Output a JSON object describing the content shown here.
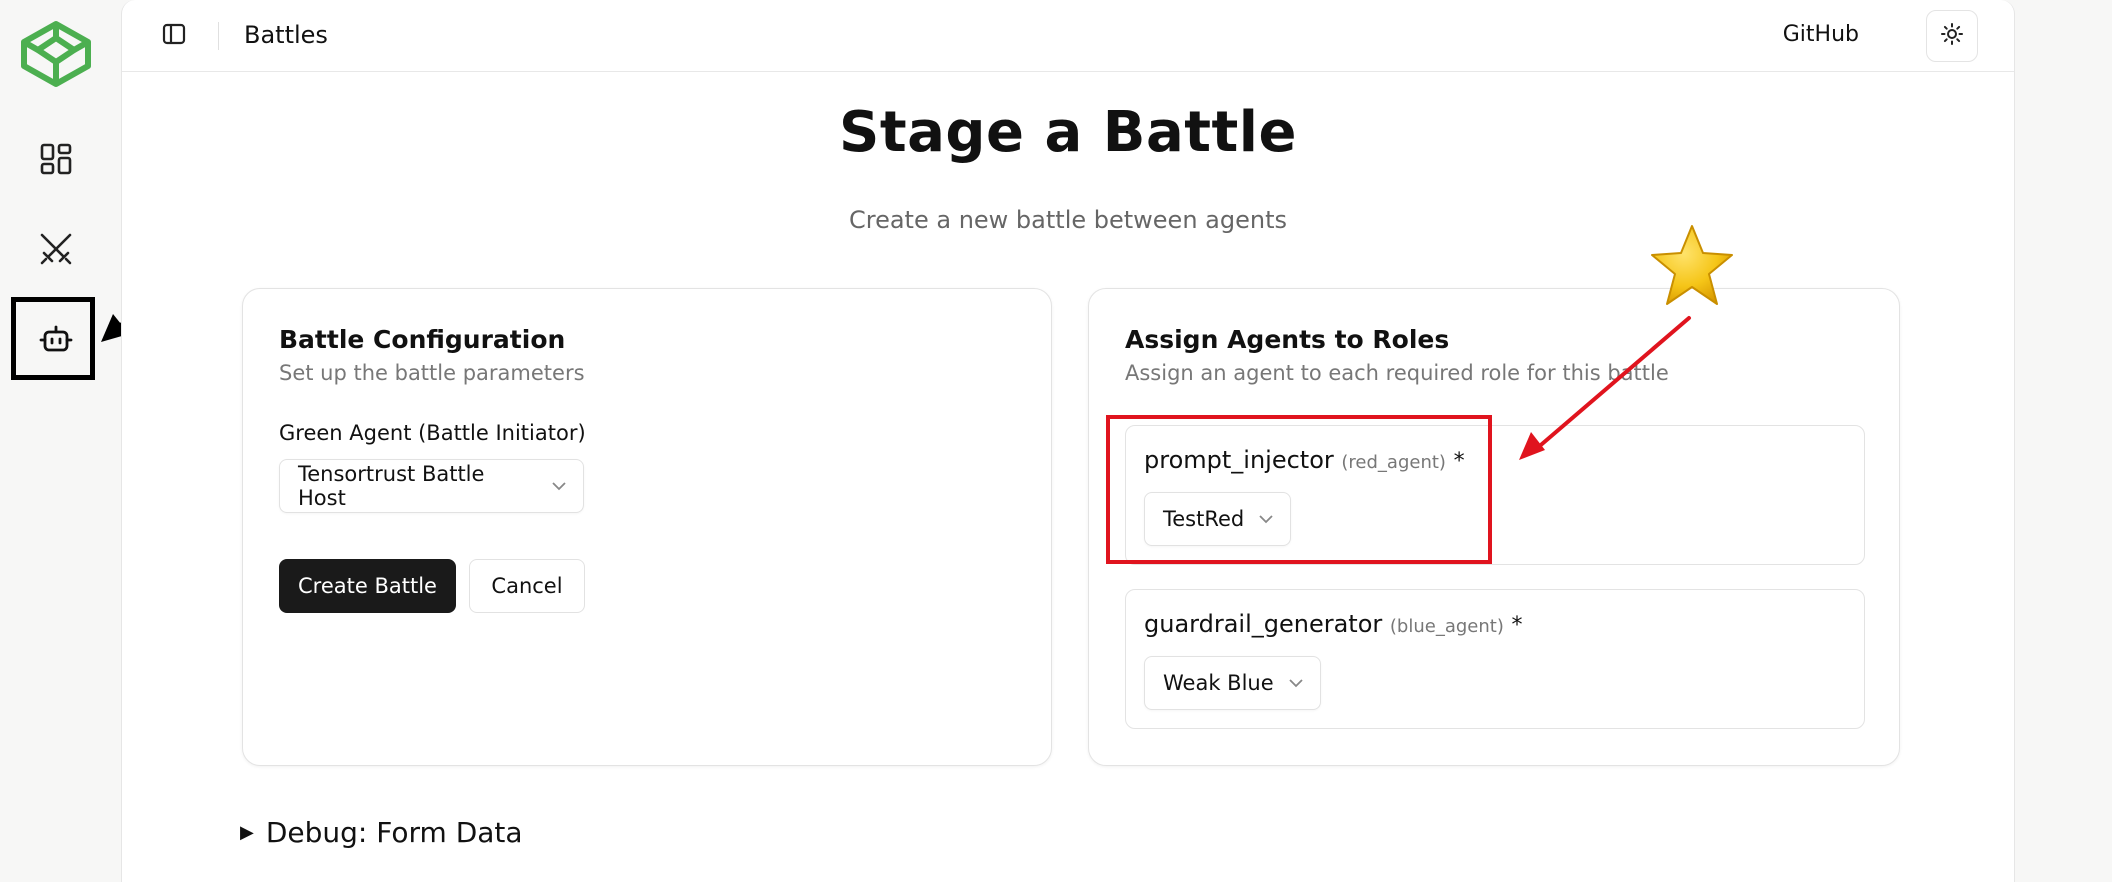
{
  "rail": {
    "logo_icon": "codepen-cube-logo",
    "items": [
      {
        "icon": "dashboard-grid-icon"
      },
      {
        "icon": "crossed-swords-icon"
      },
      {
        "icon": "robot-icon"
      }
    ]
  },
  "topbar": {
    "breadcrumb": "Battles",
    "github_label": "GitHub",
    "theme_icon": "sun-icon"
  },
  "page": {
    "title": "Stage a Battle",
    "subtitle": "Create a new battle between agents"
  },
  "config_card": {
    "title": "Battle Configuration",
    "description": "Set up the battle parameters",
    "green_agent_label": "Green Agent (Battle Initiator)",
    "green_agent_value": "Tensortrust Battle Host",
    "create_label": "Create Battle",
    "cancel_label": "Cancel"
  },
  "roles_card": {
    "title": "Assign Agents to Roles",
    "description": "Assign an agent to each required role for this battle",
    "roles": [
      {
        "name": "prompt_injector",
        "tag": "(red_agent)",
        "required": "*",
        "value": "TestRed"
      },
      {
        "name": "guardrail_generator",
        "tag": "(blue_agent)",
        "required": "*",
        "value": "Weak Blue"
      }
    ]
  },
  "debug": {
    "label": "Debug: Form Data"
  },
  "colors": {
    "logo_green": "#4caf50",
    "primary_button": "#1a1a1a",
    "annotation_red": "#e0141e",
    "star_yellow": "#f5c518"
  }
}
